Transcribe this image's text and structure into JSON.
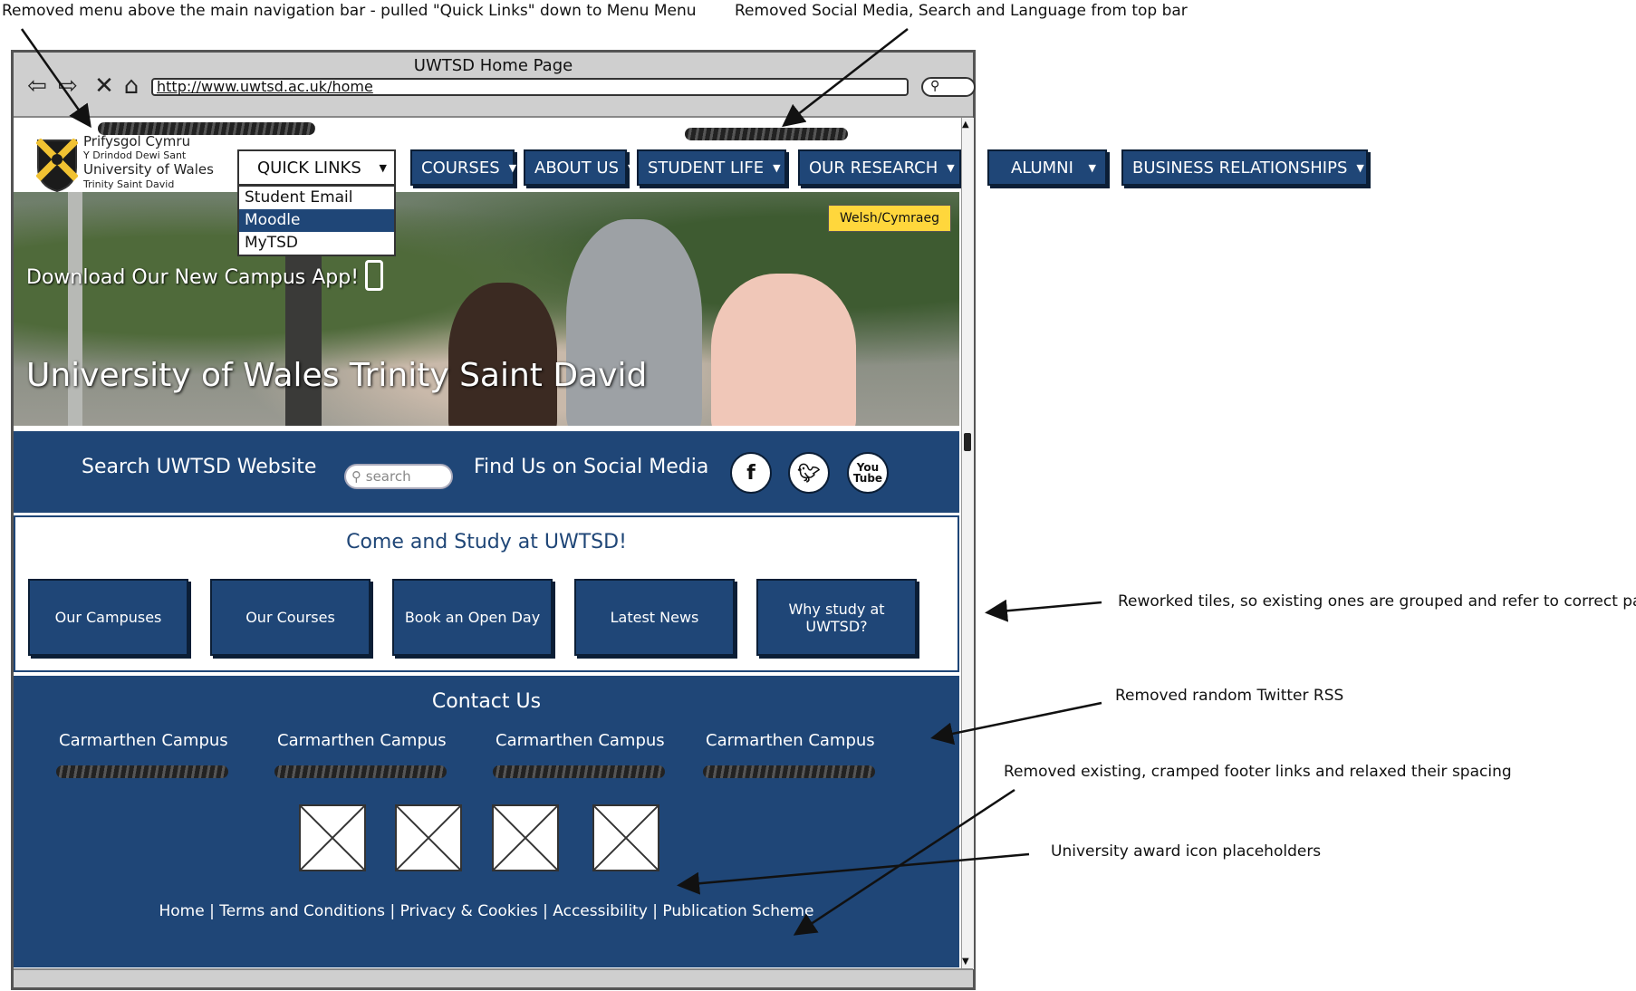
{
  "annotations": {
    "top_left": "Removed menu above the main navigation bar - pulled \"Quick Links\" down to Menu Menu",
    "top_right": "Removed Social Media, Search and Language from top bar",
    "tiles": "Reworked tiles, so existing ones are grouped and refer to correct page",
    "twitter": "Removed random Twitter RSS",
    "footer": "Removed existing, cramped footer links and relaxed their spacing",
    "awards": "University award icon placeholders"
  },
  "browser": {
    "title": "UWTSD Home Page",
    "url": "http://www.uwtsd.ac.uk/home"
  },
  "logo": {
    "line1": "Prifysgol Cymru",
    "line2": "Y Drindod Dewi Sant",
    "line3": "University of Wales",
    "line4": "Trinity Saint David"
  },
  "nav": {
    "quick_links": "QUICK LINKS",
    "quick_links_options": [
      "Student Email",
      "Moodle",
      "MyTSD"
    ],
    "items": [
      "COURSES",
      "ABOUT US",
      "STUDENT LIFE",
      "OUR RESEARCH",
      "ALUMNI",
      "BUSINESS RELATIONSHIPS"
    ]
  },
  "hero": {
    "language_button": "Welsh/Cymraeg",
    "app_text": "Download Our New Campus App!",
    "title": "University of Wales Trinity Saint David"
  },
  "band": {
    "search_label": "Search UWTSD Website",
    "search_placeholder": "search",
    "social_label": "Find Us on Social Media"
  },
  "study": {
    "title": "Come and Study at UWTSD!",
    "tiles": [
      "Our Campuses",
      "Our Courses",
      "Book an Open Day",
      "Latest News",
      "Why study at UWTSD?"
    ]
  },
  "contact": {
    "title": "Contact Us",
    "campuses": [
      "Carmarthen Campus",
      "Carmarthen Campus",
      "Carmarthen Campus",
      "Carmarthen Campus"
    ],
    "footer_links": "Home | Terms and Conditions | Privacy & Cookies | Accessibility | Publication Scheme"
  },
  "colors": {
    "brand_blue": "#1f4677",
    "language_yellow": "#ffd73c"
  }
}
